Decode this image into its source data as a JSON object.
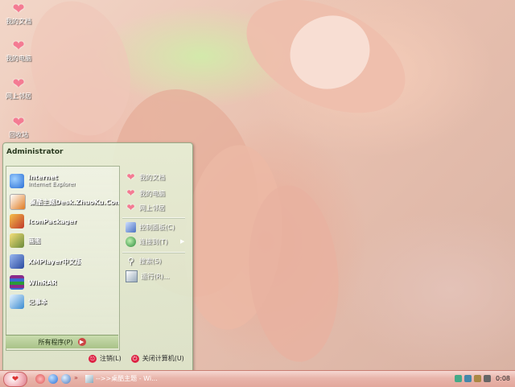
{
  "desktop_icons": [
    {
      "label": "我的文档",
      "icon": "heart-icon"
    },
    {
      "label": "我的电脑",
      "icon": "heart-icon"
    },
    {
      "label": "网上邻居",
      "icon": "heart-icon"
    },
    {
      "label": "回收站",
      "icon": "heart-icon"
    }
  ],
  "start_menu": {
    "user": "Administrator",
    "programs": [
      {
        "label": "Internet",
        "sub": "Internet Explorer",
        "icon": "ie-icon",
        "color": "#2a6fd6"
      },
      {
        "label": "桌酷主题Desk.ZhuoKu.Com",
        "sub": "",
        "icon": "zhuoku-icon",
        "color": "#e07b20"
      },
      {
        "label": "IconPackager",
        "sub": "",
        "icon": "iconpackager-icon",
        "color": "#c0392b"
      },
      {
        "label": "画图",
        "sub": "",
        "icon": "paint-icon",
        "color": "#6a8a3a"
      },
      {
        "label": "XMPlayer中文版",
        "sub": "",
        "icon": "xmplayer-icon",
        "color": "#2a4aa0"
      },
      {
        "label": "WinRAR",
        "sub": "",
        "icon": "winrar-icon",
        "color": "#8a2a8a"
      },
      {
        "label": "记事本",
        "sub": "",
        "icon": "notepad-icon",
        "color": "#3a8ad0"
      }
    ],
    "all_programs": "所有程序(P)",
    "places": [
      {
        "label": "我的文档",
        "icon": "heart-icon"
      },
      {
        "label": "我的电脑",
        "icon": "heart-icon"
      },
      {
        "label": "网上邻居",
        "icon": "heart-icon"
      }
    ],
    "system": [
      {
        "label": "控制面板(C)",
        "icon": "control-panel-icon"
      },
      {
        "label": "连接到(T)",
        "icon": "connect-icon"
      }
    ],
    "tools": [
      {
        "label": "搜索(S)",
        "icon": "search-icon"
      },
      {
        "label": "运行(R)...",
        "icon": "run-icon"
      }
    ],
    "logoff": "注销(L)",
    "shutdown": "关闭计算机(U)"
  },
  "taskbar": {
    "task_label": "-->>桌酷主题 - Wi...",
    "clock": "0:08"
  }
}
